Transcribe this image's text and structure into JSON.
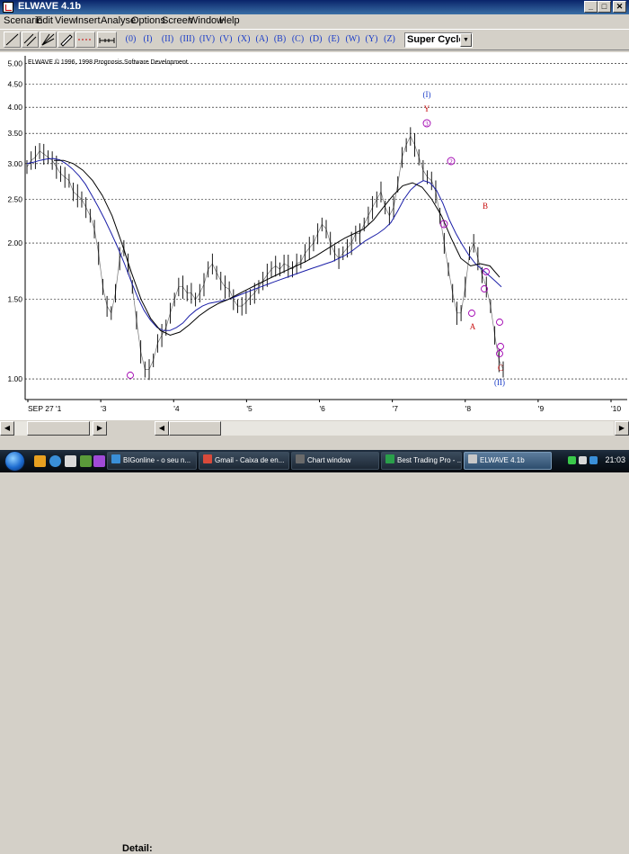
{
  "window": {
    "title": "ELWAVE 4.1b",
    "controls": [
      "minimize-icon",
      "maximize-icon",
      "close-icon"
    ]
  },
  "menu": [
    "Scenario",
    "Edit",
    "View",
    "Insert",
    "Analyse",
    "Options",
    "Screen",
    "Window",
    "Help"
  ],
  "toolbar": {
    "wave_buttons": [
      "(0)",
      "(I)",
      "(II)",
      "(III)",
      "(IV)",
      "(V)",
      "(X)",
      "(A)",
      "(B)",
      "(C)",
      "(D)",
      "(E)",
      "(W)",
      "(Y)",
      "(Z)"
    ],
    "degree_select": "Super Cycle"
  },
  "chart": {
    "copyright": "ELWAVE © 1996, 1998 Prognosis Software Development",
    "colors": {
      "price": "#000000",
      "ma_slow": "#1b1fa8",
      "ma_fast": "#000000",
      "grid": "#000000",
      "label_purple": "#a000b0",
      "label_red": "#c81010",
      "label_blue": "#1a3cc8"
    },
    "wave_labels": [
      {
        "text": "(I)",
        "color": "#1a3cc8"
      },
      {
        "text": "Y",
        "color": "#c81010"
      },
      {
        "text": "3",
        "color": "#a000b0",
        "circled": true
      },
      {
        "text": "B",
        "color": "#c81010"
      },
      {
        "text": "2",
        "color": "#a000b0",
        "circled": true
      },
      {
        "text": "1",
        "color": "#a000b0",
        "circled": true
      },
      {
        "text": "A",
        "color": "#c81010"
      },
      {
        "text": "C",
        "color": "#c81010"
      },
      {
        "text": "(II)",
        "color": "#1a3cc8"
      }
    ]
  },
  "chart_data": {
    "type": "line",
    "y_scale": "log",
    "ylim": [
      0.9,
      5.2
    ],
    "y_ticks": [
      "5.00",
      "4.50",
      "4.00",
      "3.50",
      "3.00",
      "2.50",
      "2.00",
      "1.50",
      "1.00"
    ],
    "y_tick_values": [
      5.0,
      4.5,
      4.0,
      3.5,
      3.0,
      2.5,
      2.0,
      1.5,
      1.0
    ],
    "x_ticks": [
      "SEP 27 '1",
      "'3",
      "'4",
      "'5",
      "'6",
      "'7",
      "'8",
      "'9",
      "'10"
    ],
    "series": [
      {
        "values": [
          2.95,
          3.05,
          3.1,
          3.2,
          3.15,
          3.1,
          3.05,
          2.95,
          2.85,
          2.8,
          2.75,
          2.6,
          2.55,
          2.5,
          2.4,
          2.3,
          2.15,
          1.9,
          1.6,
          1.45,
          1.4,
          1.55,
          1.85,
          1.95,
          1.8,
          1.6,
          1.35,
          1.15,
          1.05,
          1.05,
          1.1,
          1.2,
          1.25,
          1.3,
          1.4,
          1.5,
          1.6,
          1.6,
          1.55,
          1.55,
          1.5,
          1.55,
          1.62,
          1.75,
          1.8,
          1.72,
          1.65,
          1.6,
          1.58,
          1.5,
          1.45,
          1.45,
          1.48,
          1.52,
          1.55,
          1.6,
          1.65,
          1.7,
          1.75,
          1.78,
          1.75,
          1.8,
          1.78,
          1.75,
          1.8,
          1.82,
          1.9,
          1.95,
          2.0,
          2.1,
          2.2,
          2.15,
          2.0,
          1.9,
          1.85,
          1.9,
          1.95,
          2.0,
          2.1,
          2.1,
          2.2,
          2.3,
          2.4,
          2.5,
          2.6,
          2.4,
          2.3,
          2.4,
          2.7,
          3.1,
          3.3,
          3.45,
          3.3,
          3.1,
          2.9,
          2.8,
          2.75,
          2.6,
          2.3,
          2.0,
          1.75,
          1.55,
          1.4,
          1.4,
          1.6,
          1.9,
          2.0,
          1.85,
          1.7,
          1.6,
          1.45,
          1.25,
          1.1,
          1.05
        ]
      },
      {
        "values": [
          3.0,
          3.02,
          3.05,
          3.07,
          3.08,
          3.06,
          3.0,
          2.92,
          2.82,
          2.7,
          2.55,
          2.4,
          2.25,
          2.1,
          1.95,
          1.8,
          1.65,
          1.52,
          1.42,
          1.35,
          1.3,
          1.28,
          1.28,
          1.3,
          1.33,
          1.38,
          1.42,
          1.45,
          1.47,
          1.48,
          1.49,
          1.5,
          1.52,
          1.54,
          1.56,
          1.58,
          1.6,
          1.62,
          1.64,
          1.66,
          1.68,
          1.7,
          1.72,
          1.74,
          1.76,
          1.78,
          1.8,
          1.82,
          1.85,
          1.88,
          1.92,
          1.97,
          2.02,
          2.06,
          2.1,
          2.15,
          2.22,
          2.35,
          2.5,
          2.62,
          2.7,
          2.75,
          2.72,
          2.62,
          2.45,
          2.25,
          2.1,
          1.98,
          1.88,
          1.8,
          1.75,
          1.7,
          1.65,
          1.6
        ]
      },
      {
        "values": [
          3.05,
          3.05,
          3.0,
          2.9,
          2.75,
          2.55,
          2.3,
          2.0,
          1.72,
          1.5,
          1.36,
          1.28,
          1.25,
          1.27,
          1.32,
          1.38,
          1.43,
          1.47,
          1.5,
          1.54,
          1.58,
          1.62,
          1.66,
          1.7,
          1.74,
          1.78,
          1.82,
          1.87,
          1.93,
          1.99,
          2.05,
          2.1,
          2.15,
          2.25,
          2.4,
          2.55,
          2.68,
          2.72,
          2.66,
          2.5,
          2.3,
          2.05,
          1.85,
          1.78,
          1.8,
          1.78,
          1.68
        ]
      }
    ]
  },
  "scrollbar": {
    "detail_label": "Detail:"
  },
  "taskbar": {
    "tasks": [
      {
        "label": "BIGonline - o seu n...",
        "icon_color": "#3a8fd8"
      },
      {
        "label": "Gmail - Caixa de en...",
        "icon_color": "#d84a3a"
      },
      {
        "label": "Chart window",
        "icon_color": "#6a6a6a"
      },
      {
        "label": "Best Trading Pro - ...",
        "icon_color": "#2a9f4a"
      },
      {
        "label": "ELWAVE 4.1b",
        "icon_color": "#c8c8c8"
      }
    ],
    "clock": "21:03"
  }
}
